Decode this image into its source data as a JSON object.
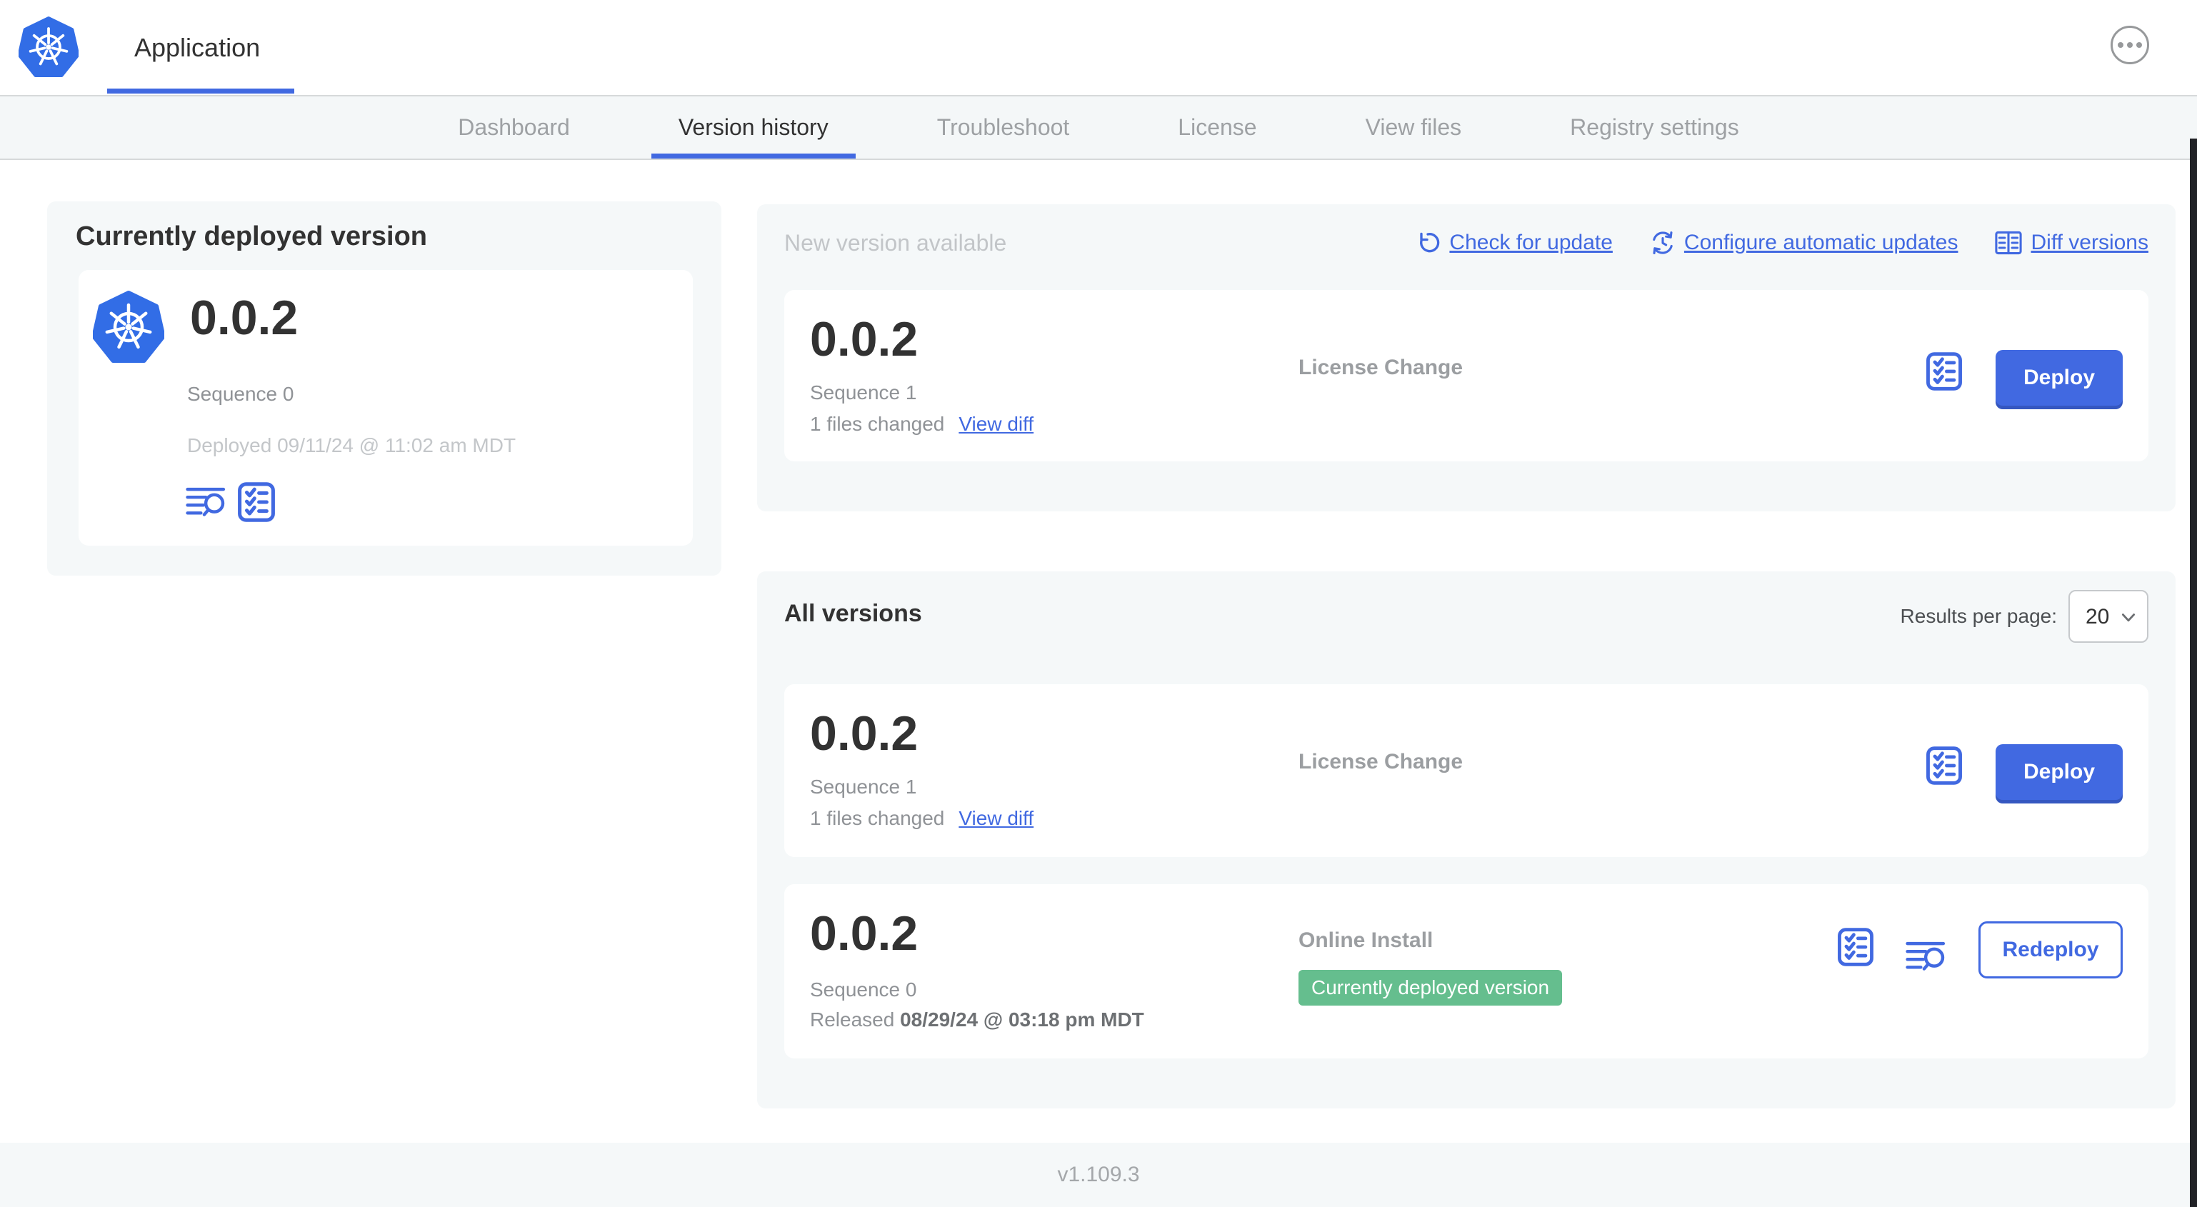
{
  "header": {
    "app_title": "Application"
  },
  "nav": {
    "tabs": [
      {
        "label": "Dashboard",
        "active": false
      },
      {
        "label": "Version history",
        "active": true
      },
      {
        "label": "Troubleshoot",
        "active": false
      },
      {
        "label": "License",
        "active": false
      },
      {
        "label": "View files",
        "active": false
      },
      {
        "label": "Registry settings",
        "active": false
      }
    ]
  },
  "currently_deployed": {
    "title": "Currently deployed version",
    "version": "0.0.2",
    "sequence": "Sequence 0",
    "deployed_at": "Deployed 09/11/24 @ 11:02 am MDT"
  },
  "new_version": {
    "section_title": "New version available",
    "actions": {
      "check_for_update": "Check for update",
      "configure_automatic_updates": "Configure automatic updates",
      "diff_versions": "Diff versions"
    },
    "version": "0.0.2",
    "sequence": "Sequence 1",
    "files_changed": "1 files changed",
    "view_diff": "View diff",
    "source": "License Change",
    "deploy_label": "Deploy"
  },
  "all_versions": {
    "title": "All versions",
    "results_per_page_label": "Results per page:",
    "results_per_page_value": "20",
    "rows": [
      {
        "version": "0.0.2",
        "sequence": "Sequence 1",
        "files_changed": "1 files changed",
        "view_diff": "View diff",
        "source": "License Change",
        "action_label": "Deploy"
      },
      {
        "version": "0.0.2",
        "sequence": "Sequence 0",
        "released_prefix": "Released ",
        "released_date": "08/29/24 @ 03:18 pm MDT",
        "source": "Online Install",
        "badge": "Currently deployed version",
        "action_label": "Redeploy"
      }
    ]
  },
  "footer": {
    "app_version": "v1.109.3"
  },
  "colors": {
    "accent_blue": "#4169e1",
    "k8s_blue": "#326de6",
    "badge_green": "#65be8e",
    "panel_gray": "#f5f8f9"
  }
}
